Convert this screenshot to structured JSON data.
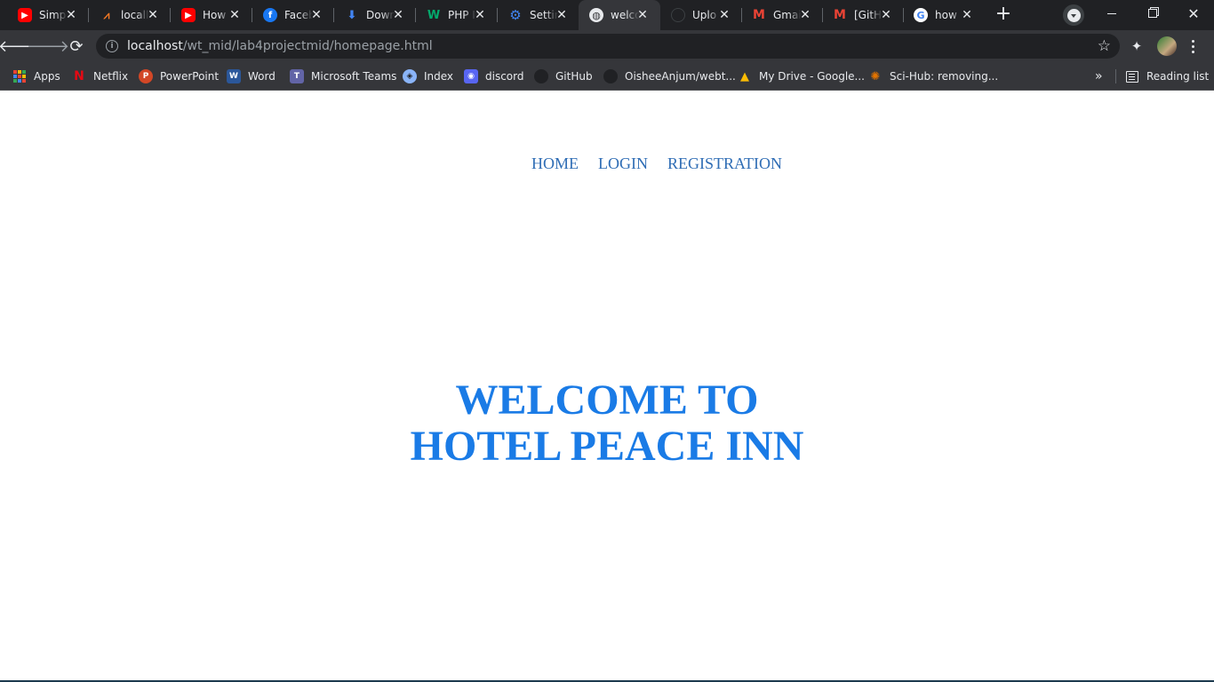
{
  "browser": {
    "tabs": [
      {
        "title": "Simp",
        "icon": "youtube-icon",
        "color": "#ff0000",
        "active": false
      },
      {
        "title": "locall",
        "icon": "xampp-icon",
        "color": "#fb7a24",
        "active": false
      },
      {
        "title": "How",
        "icon": "youtube-icon",
        "color": "#ff0000",
        "active": false
      },
      {
        "title": "Faceb",
        "icon": "facebook-icon",
        "color": "#1877f2",
        "active": false
      },
      {
        "title": "Dowr",
        "icon": "download-icon",
        "color": "#4285f4",
        "active": false
      },
      {
        "title": "PHP I",
        "icon": "w3schools-icon",
        "color": "#04aa6d",
        "active": false
      },
      {
        "title": "Settir",
        "icon": "gear-icon",
        "color": "#4285f4",
        "active": false
      },
      {
        "title": "welco",
        "icon": "globe-icon",
        "color": "#e8eaed",
        "active": true
      },
      {
        "title": "Uplo",
        "icon": "github-icon",
        "color": "#202124",
        "active": false
      },
      {
        "title": "Gmai",
        "icon": "gmail-icon",
        "color": "#ea4335",
        "active": false
      },
      {
        "title": "[GitH",
        "icon": "gmail-icon",
        "color": "#ea4335",
        "active": false
      },
      {
        "title": "how",
        "icon": "google-icon",
        "color": "#4285f4",
        "active": false
      }
    ],
    "url_host": "localhost",
    "url_path": "/wt_mid/lab4projectmid/homepage.html",
    "bookmarks": [
      {
        "label": "Apps",
        "icon": "apps-icon"
      },
      {
        "label": "Netflix",
        "icon": "netflix-icon",
        "color": "#e50914"
      },
      {
        "label": "PowerPoint",
        "icon": "powerpoint-icon",
        "color": "#d24726"
      },
      {
        "label": "Word",
        "icon": "word-icon",
        "color": "#2b579a"
      },
      {
        "label": "Microsoft Teams",
        "icon": "teams-icon",
        "color": "#6264a7"
      },
      {
        "label": "Index",
        "icon": "shield-icon",
        "color": "#8ab4f8"
      },
      {
        "label": "discord",
        "icon": "discord-icon",
        "color": "#5865f2"
      },
      {
        "label": "GitHub",
        "icon": "github-icon",
        "color": "#202124"
      },
      {
        "label": "OisheeAnjum/webt...",
        "icon": "github-icon",
        "color": "#202124"
      },
      {
        "label": "My Drive - Google...",
        "icon": "google-drive-icon",
        "color": "#fbbc04"
      },
      {
        "label": "Sci-Hub: removing...",
        "icon": "scihub-icon",
        "color": "#e37400"
      }
    ],
    "reading_list": "Reading list"
  },
  "site": {
    "nav": [
      "HOME",
      "LOGIN",
      "REGISTRATION"
    ],
    "welcome_line1": "WELCOME TO",
    "welcome_line2": "HOTEL PEACE INN",
    "link_color": "#2f6db5",
    "heading_color": "#1a7be6"
  }
}
